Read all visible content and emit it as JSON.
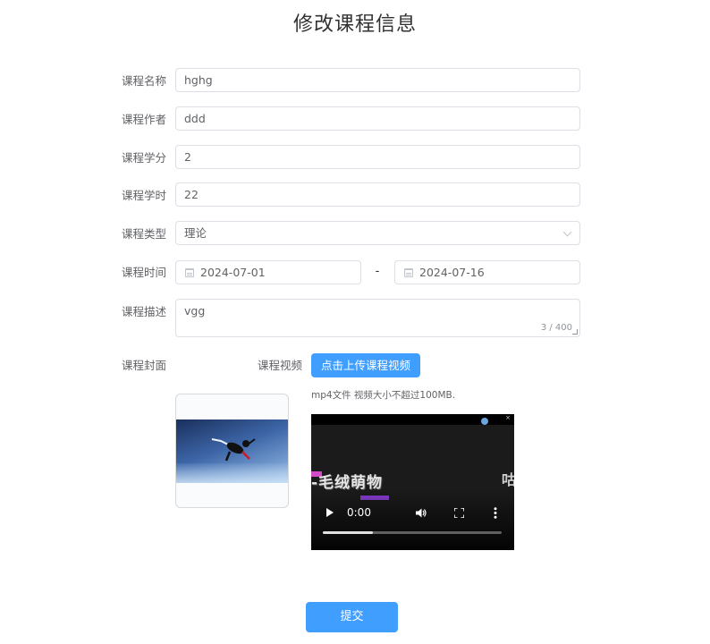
{
  "page": {
    "title": "修改课程信息"
  },
  "form": {
    "name": {
      "label": "课程名称",
      "value": "hghg"
    },
    "author": {
      "label": "课程作者",
      "value": "ddd"
    },
    "credit": {
      "label": "课程学分",
      "value": "2"
    },
    "hours": {
      "label": "课程学时",
      "value": "22"
    },
    "type": {
      "label": "课程类型",
      "value": "理论"
    },
    "time": {
      "label": "课程时间",
      "start": "2024-07-01",
      "separator": "-",
      "end": "2024-07-16"
    },
    "description": {
      "label": "课程描述",
      "value": "vgg",
      "counter": "3 / 400"
    },
    "cover": {
      "label": "课程封面"
    },
    "video": {
      "label": "课程视频",
      "upload_button": "点击上传课程视频",
      "tip": "mp4文件 视频大小不超过100MB.",
      "caption": "-毛绒萌物",
      "edge_text": "咕",
      "current_time": "0:00",
      "progress_fraction": 0.28
    },
    "submit_button": "提交"
  },
  "icons": {
    "select": "chevron-down-icon",
    "date": "calendar-icon",
    "play": "play-icon",
    "volume": "volume-icon",
    "fullscreen": "fullscreen-icon",
    "more": "more-vertical-icon"
  },
  "colors": {
    "primary": "#409eff",
    "border": "#dcdfe6",
    "text": "#606266",
    "title": "#303133"
  }
}
